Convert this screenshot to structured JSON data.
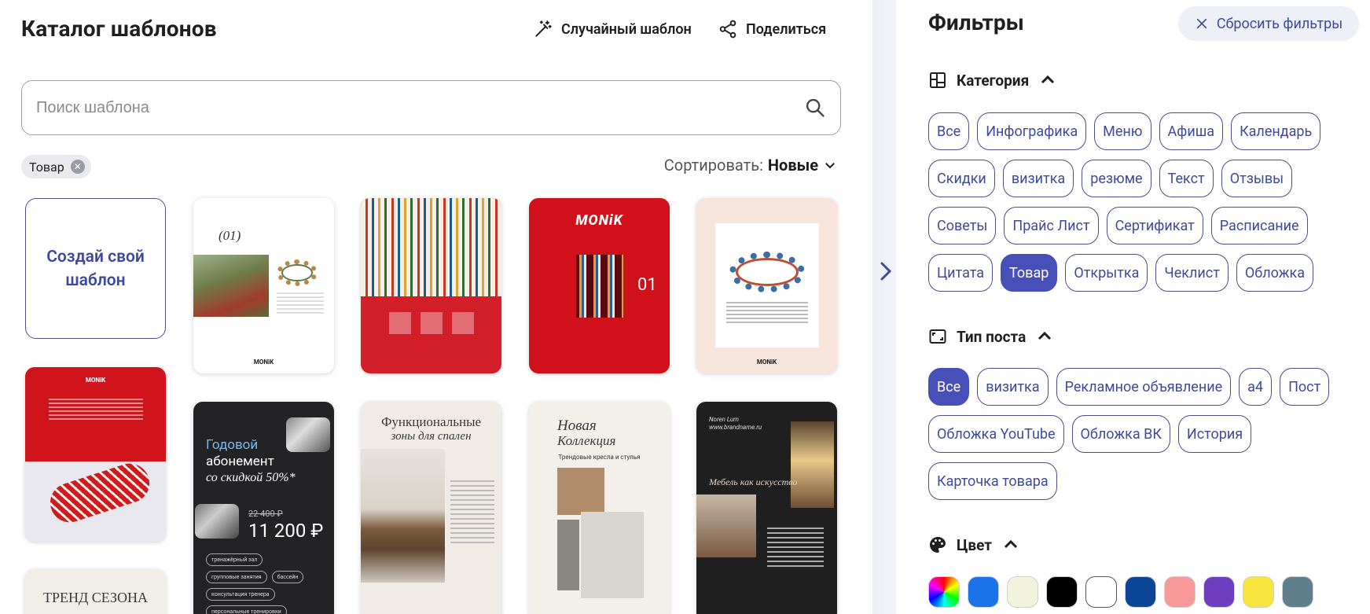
{
  "header": {
    "title": "Каталог шаблонов",
    "random_label": "Случайный шаблон",
    "share_label": "Поделиться"
  },
  "search": {
    "placeholder": "Поиск шаблона"
  },
  "active_filter": {
    "label": "Товар"
  },
  "sort": {
    "prefix": "Сортировать:",
    "value": "Новые"
  },
  "create_card": {
    "line1": "Создай свой",
    "line2": "шаблон"
  },
  "templates": [
    {
      "id": "t1",
      "texts": [
        "(01)",
        "MONiK"
      ]
    },
    {
      "id": "t2",
      "texts": []
    },
    {
      "id": "t3",
      "texts": [
        "MONiK",
        "01"
      ]
    },
    {
      "id": "t4",
      "texts": [
        "MONiK"
      ]
    },
    {
      "id": "t5",
      "texts": [
        "MONiK"
      ]
    },
    {
      "id": "t6",
      "texts": [
        "Годовой",
        "абонемент",
        "со скидкой 50%*",
        "22 400 ₽",
        "11 200 ₽",
        "тренажёрный зал",
        "групповые занятия",
        "бассейн",
        "консультация тренера",
        "персональные тренировки"
      ]
    },
    {
      "id": "t7",
      "texts": [
        "Функциональные",
        "зоны для спален"
      ]
    },
    {
      "id": "t8",
      "texts": [
        "Новая",
        "Коллекция",
        "Трендовые кресла и стулья"
      ]
    },
    {
      "id": "t9",
      "texts": [
        "Noren Lum",
        "www.brandname.ru",
        "Мебель как искусство"
      ]
    },
    {
      "id": "t10",
      "texts": [
        "ТРЕНД СЕЗОНА"
      ]
    }
  ],
  "filters": {
    "title": "Фильтры",
    "reset_label": "Сбросить фильтры",
    "category": {
      "title": "Категория",
      "items": [
        "Все",
        "Инфографика",
        "Меню",
        "Афиша",
        "Календарь",
        "Скидки",
        "визитка",
        "резюме",
        "Текст",
        "Отзывы",
        "Советы",
        "Прайс Лист",
        "Сертификат",
        "Расписание",
        "Цитата",
        "Товар",
        "Открытка",
        "Чеклист",
        "Обложка"
      ],
      "active": "Товар"
    },
    "post_type": {
      "title": "Тип поста",
      "items": [
        "Все",
        "визитка",
        "Рекламное объявление",
        "а4",
        "Пост",
        "Обложка YouTube",
        "Обложка ВК",
        "История",
        "Карточка товара"
      ],
      "active": "Все"
    },
    "color": {
      "title": "Цвет",
      "swatches": [
        "rainbow",
        "#1a73e8",
        "#f1f3dc",
        "#000000",
        "#ffffff",
        "#0d4596",
        "#f99a9a",
        "#6f3dbf",
        "#f7e43d",
        "#5f7f8c"
      ]
    }
  }
}
